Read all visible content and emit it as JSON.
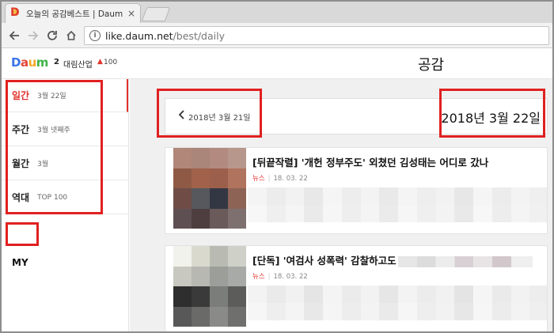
{
  "browser": {
    "tab_title": "오늘의 공감베스트 | Daum",
    "tab_close": "×",
    "address_host": "like.daum.net",
    "address_path": "/best/daily"
  },
  "header": {
    "logo": [
      "D",
      "a",
      "u",
      "m"
    ],
    "rank_number": "2",
    "rank_keyword": "대림산업",
    "rank_up_icon": "▲",
    "rank_change": "100",
    "title": "공감"
  },
  "sidebar": {
    "items": [
      {
        "main": "일간",
        "sub": "3월 22일"
      },
      {
        "main": "주간",
        "sub": "3월 넷째주"
      },
      {
        "main": "월간",
        "sub": "3월"
      },
      {
        "main": "역대",
        "sub": "TOP 100"
      }
    ],
    "my": "MY"
  },
  "datebar": {
    "prev": "2018년 3월 21일",
    "current": "2018년 3월 22일"
  },
  "articles": [
    {
      "title": "[뒤끝작렬] '개헌 정부주도' 외쳤던 김성태는 어디로 갔나",
      "category": "뉴스",
      "date": "18. 03. 22"
    },
    {
      "title": "[단독] '여검사 성폭력' 감찰하고도",
      "category": "뉴스",
      "date": "18. 03. 22"
    }
  ],
  "colors": {
    "accent_red": "#e1322c",
    "annotation_red": "#e02020"
  },
  "icons": {
    "back": "arrow-left-icon",
    "forward": "arrow-right-icon",
    "reload": "reload-icon",
    "home": "home-icon",
    "info": "info-icon",
    "prev_date": "chevron-left-icon"
  }
}
